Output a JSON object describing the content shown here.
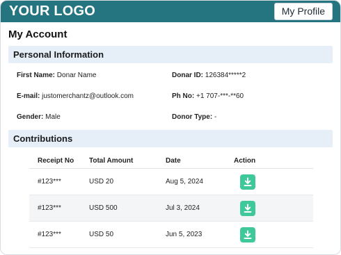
{
  "header": {
    "logo_text": "YOUR LOGO",
    "profile_button": "My Profile",
    "bar_color": "#24757f"
  },
  "page_title": "My Account",
  "personal": {
    "section_title": "Personal Information",
    "first_name": {
      "label": "First Name:",
      "value": "Donar Name"
    },
    "donor_id": {
      "label": "Donar ID:",
      "value": "126384*****2"
    },
    "email": {
      "label": "E-mail:",
      "value": "justomerchantz@outlook.com"
    },
    "phone": {
      "label": "Ph No:",
      "value": "+1 707-***-**60"
    },
    "gender": {
      "label": "Gender:",
      "value": "Male"
    },
    "donor_type": {
      "label": "Donor Type:",
      "value": "-"
    }
  },
  "contributions": {
    "section_title": "Contributions",
    "columns": [
      "Receipt No",
      "Total Amount",
      "Date",
      "Action"
    ],
    "rows": [
      {
        "receipt": "#123***",
        "amount": "USD 20",
        "date": "Aug 5, 2024",
        "action_icon": "download-icon"
      },
      {
        "receipt": "#123***",
        "amount": "USD 500",
        "date": "Jul 3, 2024",
        "action_icon": "download-icon"
      },
      {
        "receipt": "#123***",
        "amount": "USD 50",
        "date": "Jun 5, 2023",
        "action_icon": "download-icon"
      }
    ],
    "action_color": "#3fc99a"
  }
}
